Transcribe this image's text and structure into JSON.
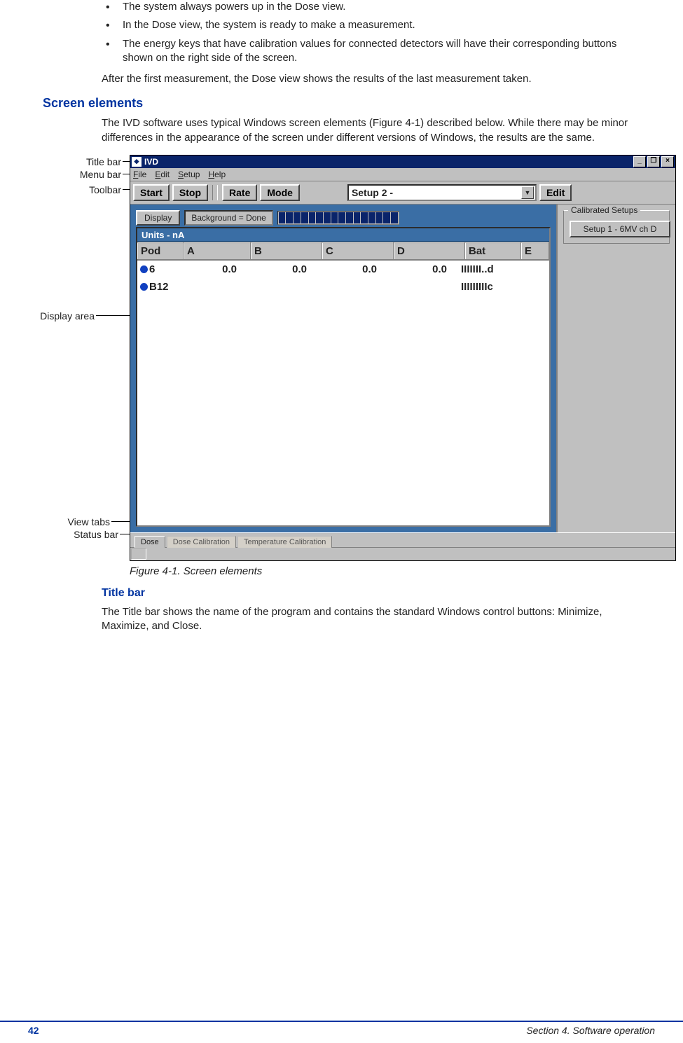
{
  "bullets": [
    "The system always powers up in the Dose view.",
    "In the Dose view, the system is ready to make a measurement.",
    "The energy keys that have calibration values for connected detectors will have their corresponding buttons shown on the right side of the screen."
  ],
  "after_para": "After the first measurement, the Dose view shows the results of the last measurement taken.",
  "section_head": "Screen elements",
  "section_para": "The IVD software uses typical Windows screen elements (Figure 4-1) described below. While there may be minor differences in the appearance of the screen under different versions of Windows, the results are the same.",
  "callouts": {
    "titlebar": "Title bar",
    "menubar": "Menu bar",
    "toolbar": "Toolbar",
    "display": "Display area",
    "viewtabs": "View tabs",
    "statusbar": "Status bar"
  },
  "app": {
    "title": "IVD",
    "menus": {
      "file": "File",
      "edit": "Edit",
      "setup": "Setup",
      "help": "Help"
    },
    "toolbar": {
      "start": "Start",
      "stop": "Stop",
      "rate": "Rate",
      "mode": "Mode",
      "setup_combo": "Setup 2 -",
      "edit": "Edit"
    },
    "status_row": {
      "display_btn": "Display",
      "background": "Background = Done"
    },
    "grid": {
      "units": "Units - nA",
      "headers": {
        "pod": "Pod",
        "a": "A",
        "b": "B",
        "c": "C",
        "d": "D",
        "bat": "Bat",
        "e": "E"
      },
      "rows": [
        {
          "pod": "6",
          "a": "0.0",
          "b": "0.0",
          "c": "0.0",
          "d": "0.0",
          "bat": "IIIIIII..d",
          "e": ""
        },
        {
          "pod": "B12",
          "a": "",
          "b": "",
          "c": "",
          "d": "",
          "bat": "IIIIIIIIIc",
          "e": ""
        }
      ]
    },
    "right": {
      "group_title": "Calibrated Setups",
      "setup_btn": "Setup 1 - 6MV ch D"
    },
    "tabs": {
      "dose": "Dose",
      "dosecal": "Dose Calibration",
      "tempcal": "Temperature Calibration"
    }
  },
  "figure_caption": "Figure 4-1. Screen elements",
  "subhead": "Title bar",
  "sub_para": "The Title bar shows the name of the program and contains the standard Windows control buttons: Minimize, Maximize, and Close.",
  "footer": {
    "page": "42",
    "section": "Section 4. Software operation"
  }
}
